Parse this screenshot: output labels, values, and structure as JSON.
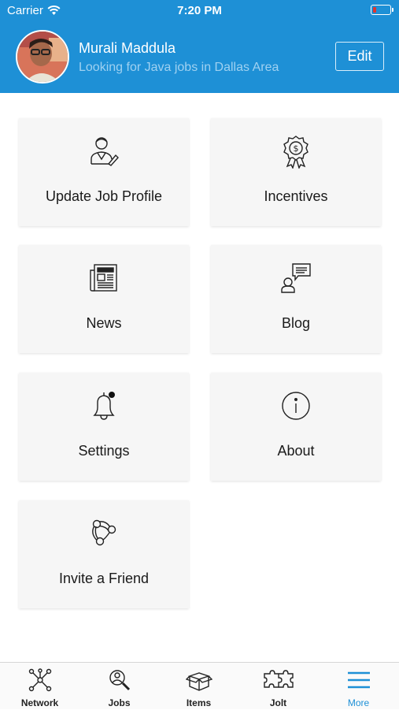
{
  "status_bar": {
    "carrier": "Carrier",
    "time": "7:20 PM",
    "battery_level": 0.2
  },
  "header": {
    "name": "Murali Maddula",
    "subtitle": "Looking for Java jobs in Dallas Area",
    "edit_label": "Edit"
  },
  "tiles": [
    {
      "label": "Update Job Profile",
      "icon": "job-profile-icon"
    },
    {
      "label": "Incentives",
      "icon": "award-ribbon-icon"
    },
    {
      "label": "News",
      "icon": "newspaper-icon"
    },
    {
      "label": "Blog",
      "icon": "blog-chat-icon"
    },
    {
      "label": "Settings",
      "icon": "bell-icon"
    },
    {
      "label": "About",
      "icon": "info-icon"
    },
    {
      "label": "Invite a Friend",
      "icon": "share-icon"
    }
  ],
  "tabbar": {
    "items": [
      {
        "label": "Network",
        "icon": "network-icon",
        "active": false
      },
      {
        "label": "Jobs",
        "icon": "jobs-search-icon",
        "active": false
      },
      {
        "label": "Items",
        "icon": "box-icon",
        "active": false
      },
      {
        "label": "Jolt",
        "icon": "puzzle-icon",
        "active": false
      },
      {
        "label": "More",
        "icon": "menu-icon",
        "active": true
      }
    ]
  },
  "colors": {
    "accent": "#1e90d6",
    "subtitle": "#9fd1f1",
    "tile_bg": "#f6f6f6"
  }
}
